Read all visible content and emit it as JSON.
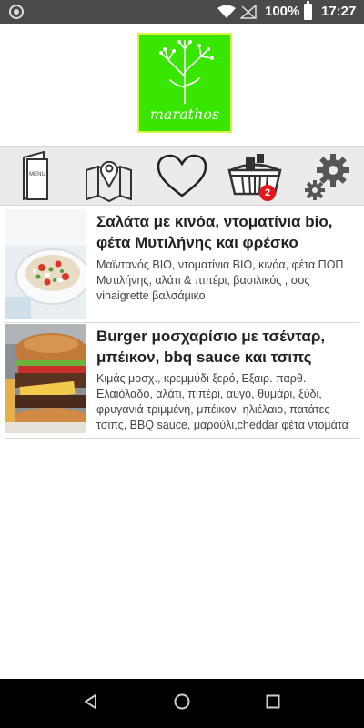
{
  "status_bar": {
    "battery_percent": "100%",
    "time": "17:27"
  },
  "logo": {
    "text": "marathos",
    "color": "#39e600"
  },
  "toolbar": {
    "items": [
      {
        "name": "menu-icon",
        "label": "MENU"
      },
      {
        "name": "map-icon"
      },
      {
        "name": "favorites-icon"
      },
      {
        "name": "cart-icon"
      },
      {
        "name": "settings-icon"
      }
    ],
    "cart_badge": "2",
    "badge_color": "#e8151b"
  },
  "items": [
    {
      "title": "Σαλάτα με κινόα, ντοματίνια bio, φέτα Μυτιλήνης και φρέσκο",
      "description": "Μαϊντανός BIO, ντοματίνια BIO, κινόα, φέτα ΠΟΠ Μυτιλήνης, αλάτι & πιπέρι, βασιλικός , σος vinaigrette βαλσάμικο"
    },
    {
      "title": "Burger μοσχαρίσιο με τσένταρ, μπέικον, bbq sauce και τσιπς",
      "description": " Κιμάς μοσχ., κρεμμύδι ξερό, Εξαιρ. παρθ. Ελαιόλαδο, αλάτι, πιπέρι, αυγό, θυμάρι, ξύδι, φρυγανιά τριμμένη, μπέικον, ηλιέλαιο, πατάτες τσιπς, BBQ sauce, μαρούλι,cheddar φέτα ντομάτα πίκλες"
    }
  ]
}
